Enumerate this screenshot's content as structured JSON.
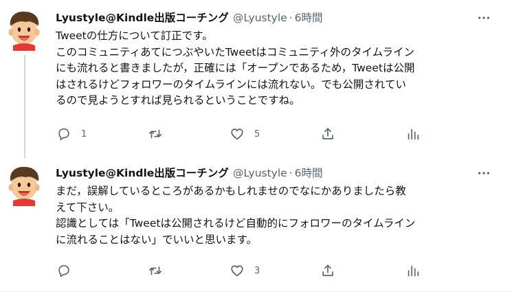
{
  "tweets": [
    {
      "author": {
        "name": "Lyustyle@Kindle出版コーチング",
        "handle": "@Lyustyle",
        "separator": "·",
        "time": "6時間"
      },
      "body_lines": [
        "Tweetの仕方について訂正です。",
        "このコミュニティあてにつぶやいたTweetはコミュニティ外のタイムライン\nにも流れると書きましたが，正確には「オープンであるため，Tweetは公開\nはされるけどフォロワーのタイムラインには流れない。でも公開されてい\nるので見ようとすれば見られるということですね。"
      ],
      "actions": {
        "reply_count": "1",
        "retweet_count": "",
        "like_count": "5"
      },
      "has_thread_line": true
    },
    {
      "author": {
        "name": "Lyustyle@Kindle出版コーチング",
        "handle": "@Lyustyle",
        "separator": "·",
        "time": "6時間"
      },
      "body_lines": [
        "まだ，誤解しているところがあるかもしれませのでなにかありましたら教\nえて下さい。",
        "認識としては「Tweetは公開されるけど自動的にフォロワーのタイムライン\nに流れることはない」でいいと思います。"
      ],
      "actions": {
        "reply_count": "",
        "retweet_count": "",
        "like_count": "3"
      },
      "has_thread_line": false
    }
  ],
  "icons": {
    "reply": "reply-icon",
    "retweet": "retweet-icon",
    "like": "heart-icon",
    "share": "share-icon",
    "stats": "analytics-icon",
    "more": "more-icon"
  },
  "colors": {
    "text": "#0f1419",
    "secondary": "#536471",
    "thread_line": "#cfd9de",
    "divider": "#eff3f4"
  }
}
